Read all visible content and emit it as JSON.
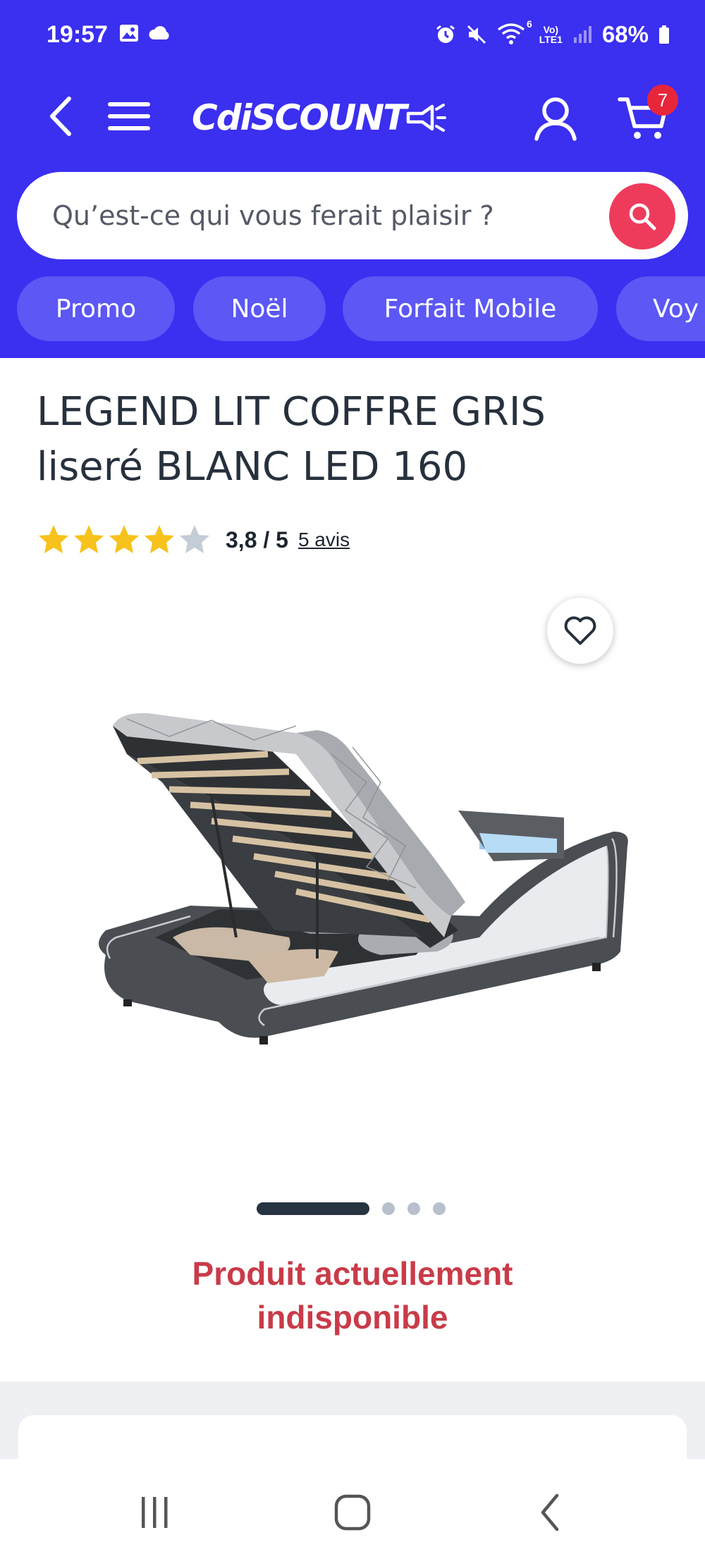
{
  "status_bar": {
    "time": "19:57",
    "network_label_top": "Vo)",
    "network_label_bottom": "LTE1",
    "wifi_label": "6",
    "battery": "68%"
  },
  "header": {
    "logo_text": "CdiSCOUNT",
    "cart_count": "7",
    "brand_color": "#3b2ff0"
  },
  "search": {
    "placeholder": "Qu’est-ce qui vous ferait plaisir ?"
  },
  "chips": [
    {
      "label": "Promo"
    },
    {
      "label": "Noël"
    },
    {
      "label": "Forfait Mobile"
    },
    {
      "label": "Voy"
    }
  ],
  "product": {
    "title_line1": "LEGEND LIT COFFRE GRIS",
    "title_line2": "liseré BLANC LED 160",
    "rating": 3.8,
    "rating_text": "3,8 / 5",
    "reviews_text": "5 avis",
    "unavailable_line1": "Produit actuellement",
    "unavailable_line2": "indisponible",
    "carousel_count": 4,
    "carousel_active": 1
  },
  "colors": {
    "star_filled": "#f7c21b",
    "star_empty": "#c4ccd6",
    "unavailable": "#c93b49",
    "search_button": "#ee3b5c",
    "chip": "#5c57f5"
  }
}
